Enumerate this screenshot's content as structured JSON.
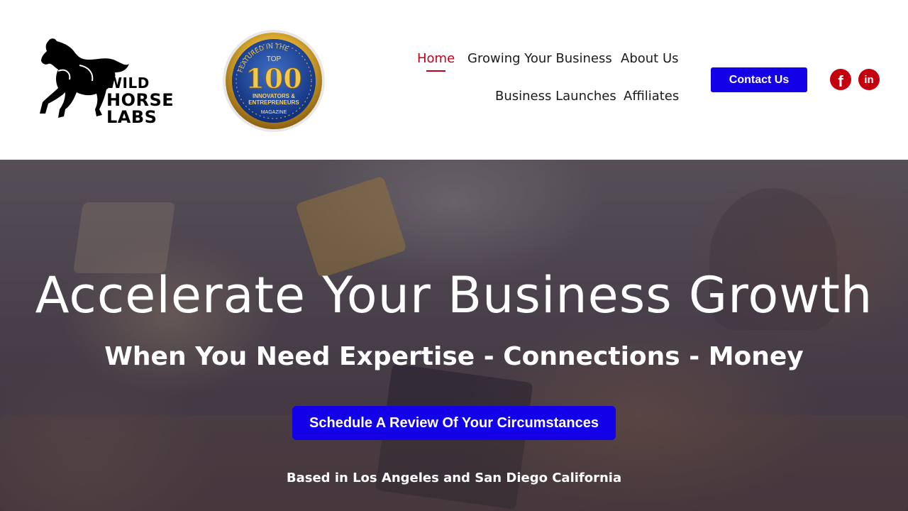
{
  "header": {
    "logo": {
      "line1": "WILD",
      "line2": "HORSE",
      "line3": "LABS",
      "icon": "horse-icon"
    },
    "badge": {
      "arc_text": "FEATURED IN THE",
      "top": "TOP",
      "number": "100",
      "line1": "INNOVATORS &",
      "line2": "ENTREPRENEURS",
      "footer": "MAGAZINE"
    },
    "nav": [
      {
        "label": "Home",
        "active": true
      },
      {
        "label": "Growing Your Business",
        "active": false
      },
      {
        "label": "About Us",
        "active": false
      },
      {
        "label": "Business Launches",
        "active": false
      },
      {
        "label": "Affiliates",
        "active": false
      }
    ],
    "contact_button": "Contact Us",
    "social": [
      {
        "icon": "facebook-icon",
        "glyph": "f"
      },
      {
        "icon": "linkedin-icon",
        "glyph": "in"
      }
    ]
  },
  "hero": {
    "title": "Accelerate Your Business Growth",
    "subtitle": "When You Need Expertise - Connections - Money",
    "cta_button": "Schedule A Review Of Your Circumstances",
    "note": "Based in Los Angeles and San Diego California"
  },
  "colors": {
    "accent_blue": "#1400e6",
    "active_red": "#c0001a",
    "social_red": "#c4000e"
  }
}
